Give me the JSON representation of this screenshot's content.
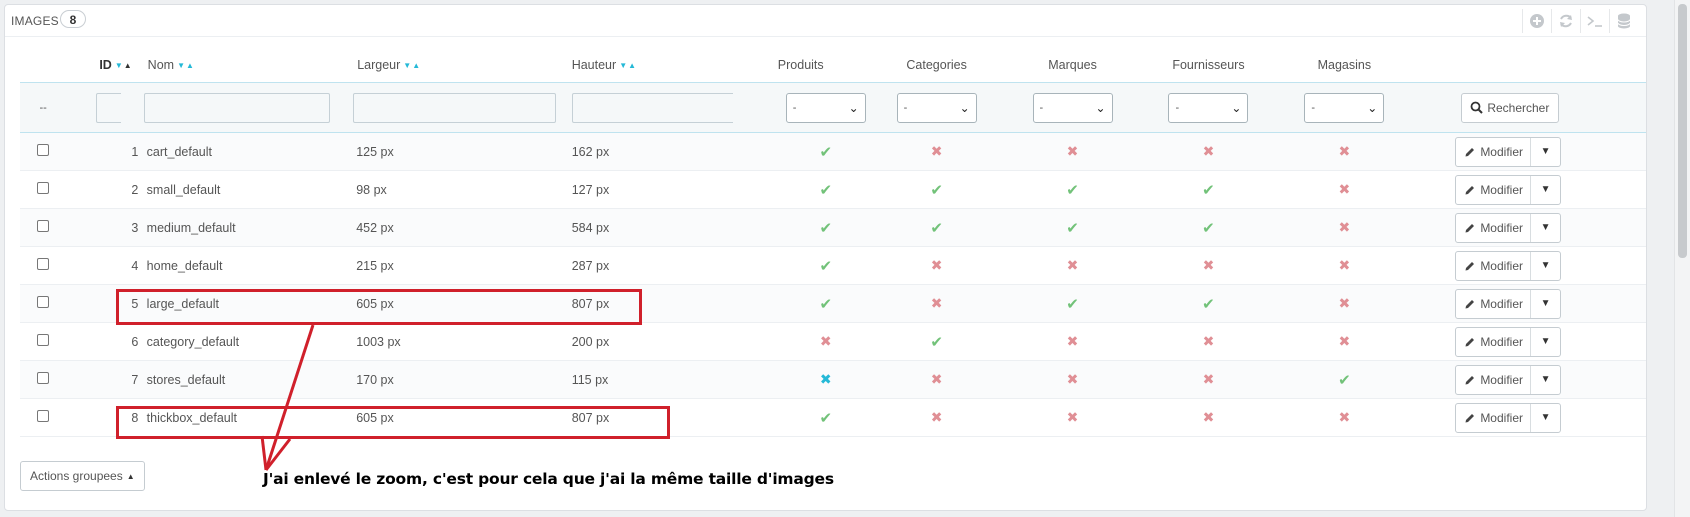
{
  "panel": {
    "title": "IMAGES",
    "count": "8"
  },
  "header_icons": [
    "add-icon",
    "refresh-icon",
    "terminal-icon",
    "database-icon"
  ],
  "columns": {
    "id": "ID",
    "name": "Nom",
    "width": "Largeur",
    "height": "Hauteur",
    "products": "Produits",
    "categories": "Categories",
    "brands": "Marques",
    "suppliers": "Fournisseurs",
    "stores": "Magasins"
  },
  "filter": {
    "bulk_placeholder": "--",
    "select_value": "-",
    "search_label": "Rechercher"
  },
  "rows": [
    {
      "id": "1",
      "name": "cart_default",
      "width": "125 px",
      "height": "162 px",
      "flags": [
        "ok",
        "no",
        "no",
        "no",
        "no"
      ]
    },
    {
      "id": "2",
      "name": "small_default",
      "width": "98 px",
      "height": "127 px",
      "flags": [
        "ok",
        "ok",
        "ok",
        "ok",
        "no"
      ]
    },
    {
      "id": "3",
      "name": "medium_default",
      "width": "452 px",
      "height": "584 px",
      "flags": [
        "ok",
        "ok",
        "ok",
        "ok",
        "no"
      ]
    },
    {
      "id": "4",
      "name": "home_default",
      "width": "215 px",
      "height": "287 px",
      "flags": [
        "ok",
        "no",
        "no",
        "no",
        "no"
      ]
    },
    {
      "id": "5",
      "name": "large_default",
      "width": "605 px",
      "height": "807 px",
      "flags": [
        "ok",
        "no",
        "ok",
        "ok",
        "no"
      ]
    },
    {
      "id": "6",
      "name": "category_default",
      "width": "1003 px",
      "height": "200 px",
      "flags": [
        "no",
        "ok",
        "no",
        "no",
        "no"
      ]
    },
    {
      "id": "7",
      "name": "stores_default",
      "width": "170 px",
      "height": "115 px",
      "flags": [
        "noblue",
        "no",
        "no",
        "no",
        "ok"
      ]
    },
    {
      "id": "8",
      "name": "thickbox_default",
      "width": "605 px",
      "height": "807 px",
      "flags": [
        "ok",
        "no",
        "no",
        "no",
        "no"
      ]
    }
  ],
  "row_action": {
    "edit_label": "Modifier"
  },
  "bulk_actions_label": "Actions groupees",
  "annotation": {
    "text": "J'ai enlevé le zoom, c'est pour cela que j'ai la même taille d'images",
    "color": "#d0202b"
  },
  "colors": {
    "ok": "#72c279",
    "no": "#e08f95",
    "accent": "#25b9d7"
  }
}
